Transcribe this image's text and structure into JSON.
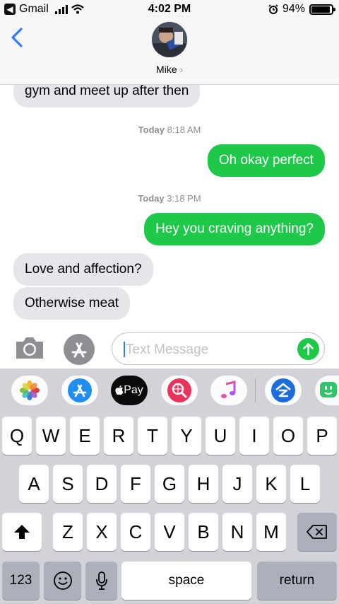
{
  "status_bar": {
    "back_app": "Gmail",
    "time": "4:02 PM",
    "battery_text": "94%",
    "battery_level": 0.94
  },
  "header": {
    "contact_name": "Mike",
    "chevron": "›"
  },
  "messages": [
    {
      "kind": "received",
      "text": "gym and meet up after then"
    },
    {
      "kind": "timestamp",
      "day": "Today",
      "time": "8:18 AM"
    },
    {
      "kind": "sent",
      "text": "Oh okay perfect"
    },
    {
      "kind": "timestamp",
      "day": "Today",
      "time": "3:18 PM"
    },
    {
      "kind": "sent",
      "text": "Hey you craving anything?"
    },
    {
      "kind": "received",
      "text": "Love and affection?"
    },
    {
      "kind": "received",
      "text": "Otherwise meat"
    }
  ],
  "input": {
    "placeholder": "Text Message"
  },
  "app_strip": {
    "apple_pay_label": "Pay",
    "icons": [
      "photos-icon",
      "app-store-icon",
      "apple-pay-icon",
      "web-search-icon",
      "music-icon",
      "zillow-icon",
      "sticker-app-icon"
    ]
  },
  "keyboard": {
    "row1": [
      "Q",
      "W",
      "E",
      "R",
      "T",
      "Y",
      "U",
      "I",
      "O",
      "P"
    ],
    "row2": [
      "A",
      "S",
      "D",
      "F",
      "G",
      "H",
      "J",
      "K",
      "L"
    ],
    "row3": [
      "Z",
      "X",
      "C",
      "V",
      "B",
      "N",
      "M"
    ],
    "numbers_label": "123",
    "space_label": "space",
    "return_label": "return"
  },
  "colors": {
    "sent_bubble": "#1ec94a",
    "received_bubble": "#e5e5ea",
    "accent": "#2f7cf6"
  }
}
